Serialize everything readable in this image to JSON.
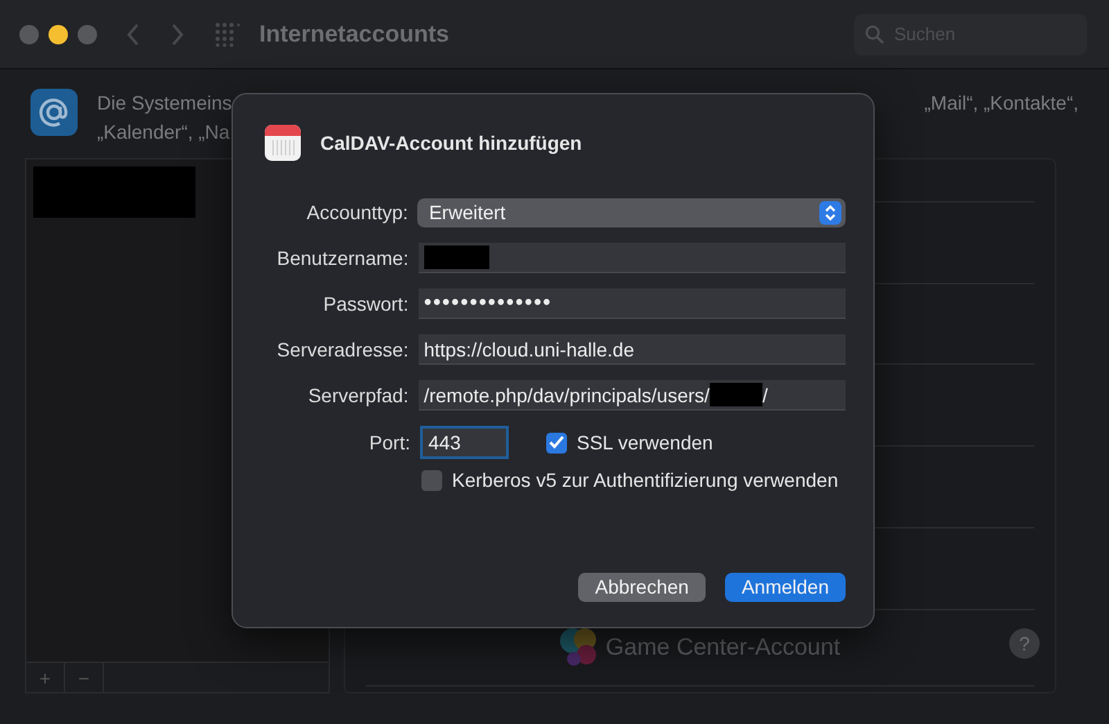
{
  "window": {
    "title": "Internetaccounts",
    "search": {
      "placeholder": "Suchen"
    }
  },
  "description": {
    "line_1_start": "Die Systemeins",
    "line_1_end": "„Mail“, „Kontakte“,",
    "line_2": "„Kalender“, „Na"
  },
  "account_list": {
    "buttons": [
      "+",
      "−"
    ]
  },
  "right_panel": {
    "items": [
      {
        "label": "Game Center-Account"
      }
    ],
    "help": "?"
  },
  "dialog": {
    "title": "CalDAV-Account hinzufügen",
    "fields": [
      {
        "kind": "select",
        "label": "Accounttyp:",
        "value": "Erweitert"
      },
      {
        "kind": "redacted",
        "label": "Benutzername:"
      },
      {
        "kind": "text",
        "label": "Passwort:",
        "value": "••••••••••••••"
      },
      {
        "kind": "text",
        "label": "Serveradresse:",
        "value": "https://cloud.uni-halle.de"
      },
      {
        "kind": "path",
        "label": "Serverpfad:",
        "value": "/remote.php/dav/principals/users/",
        "value_end": "/"
      }
    ],
    "port": {
      "label": "Port:",
      "value": "443",
      "focused": true
    },
    "checkboxes": [
      {
        "label": "SSL verwenden",
        "checked": true
      },
      {
        "label": "Kerberos v5 zur Authentifizierung verwenden",
        "checked": false
      }
    ],
    "buttons": [
      {
        "label": "Abbrechen",
        "primary": false
      },
      {
        "label": "Anmelden",
        "primary": true
      }
    ]
  }
}
